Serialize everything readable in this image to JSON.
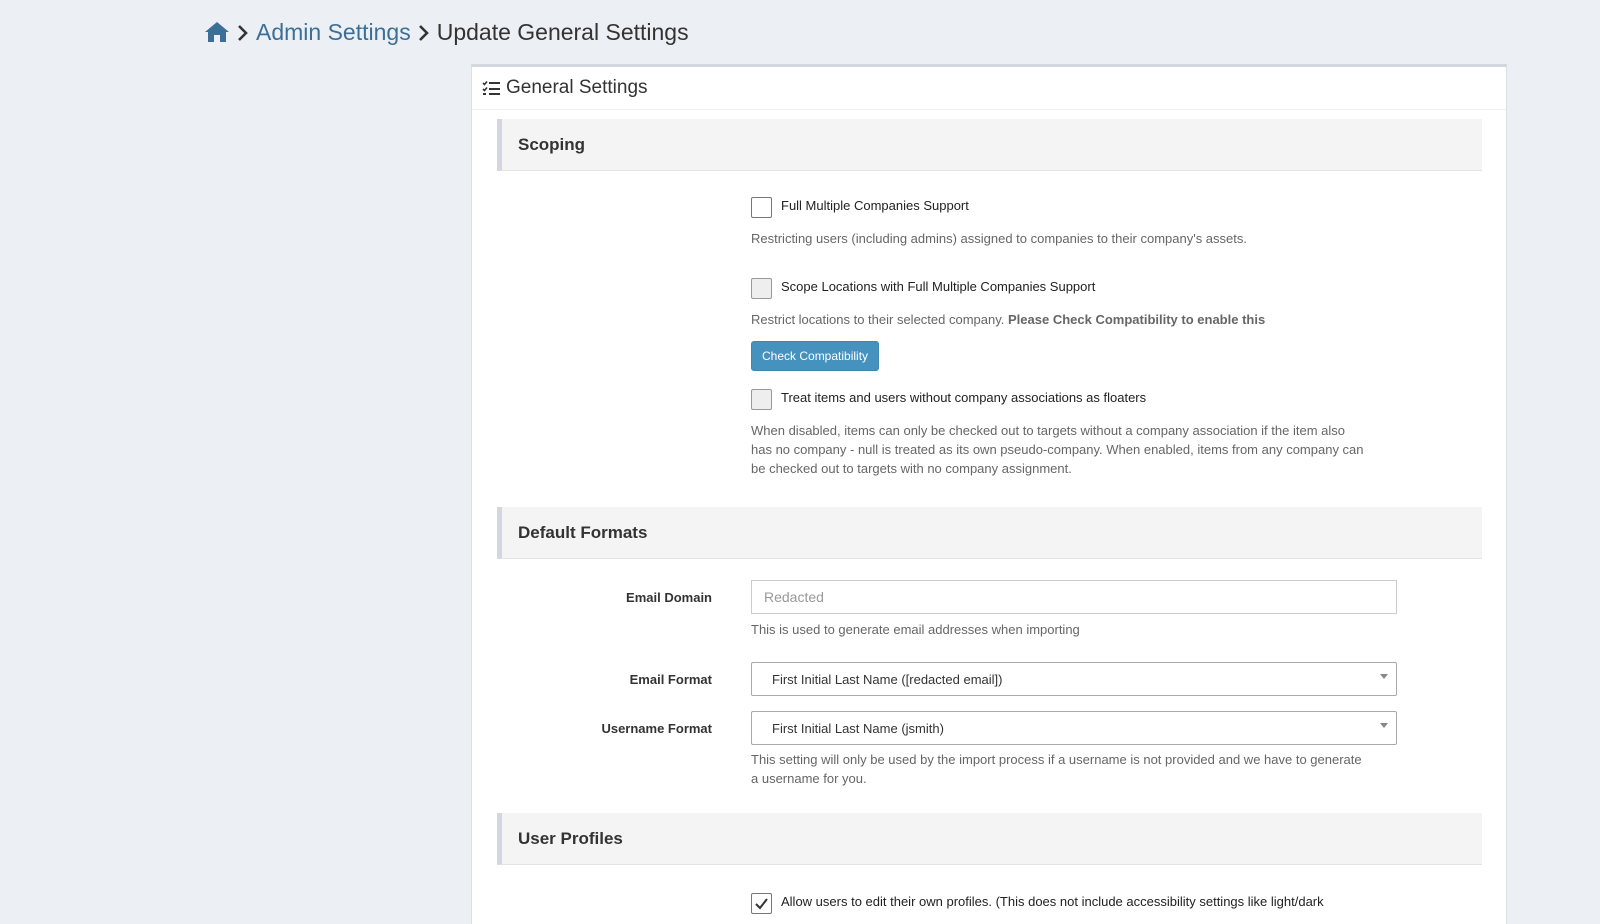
{
  "breadcrumb": {
    "home_icon": "home-icon",
    "items": [
      "Admin Settings",
      "Update General Settings"
    ]
  },
  "panel": {
    "title": "General Settings",
    "title_icon": "tasks-list-icon"
  },
  "sections": {
    "scoping": {
      "title": "Scoping",
      "full_mcs": {
        "label": "Full Multiple Companies Support",
        "checked": false,
        "help": "Restricting users (including admins) assigned to companies to their company's assets."
      },
      "scope_locations": {
        "label": "Scope Locations with Full Multiple Companies Support",
        "checked": false,
        "disabled": true,
        "help": "Restrict locations to their selected company.",
        "help_bold": "Please Check Compatibility to enable this",
        "button": "Check Compatibility"
      },
      "floaters": {
        "label": "Treat items and users without company associations as floaters",
        "checked": false,
        "disabled": true,
        "help_lines": [
          "When disabled, items can only be checked out to targets without a company association if the item also",
          "has no company - null is treated as its own pseudo-company. When enabled, items from any company can",
          "be checked out to targets with no company assignment."
        ]
      }
    },
    "default_formats": {
      "title": "Default Formats",
      "email_domain": {
        "label": "Email Domain",
        "placeholder": "Redacted",
        "help": "This is used to generate email addresses when importing"
      },
      "email_format": {
        "label": "Email Format",
        "value": "First Initial Last Name ([redacted email])"
      },
      "username_format": {
        "label": "Username Format",
        "value": "First Initial Last Name (jsmith)",
        "help_lines": [
          "This setting will only be used by the import process if a username is not provided and we have to generate",
          "a username for you."
        ]
      }
    },
    "user_profiles": {
      "title": "User Profiles",
      "allow_edit": {
        "label": "Allow users to edit their own profiles. (This does not include accessibility settings like light/dark",
        "checked": true
      }
    }
  },
  "colors": {
    "link": "#3c6f96",
    "primary_button": "#3c8dbc",
    "page_background": "#ecf0f5"
  }
}
